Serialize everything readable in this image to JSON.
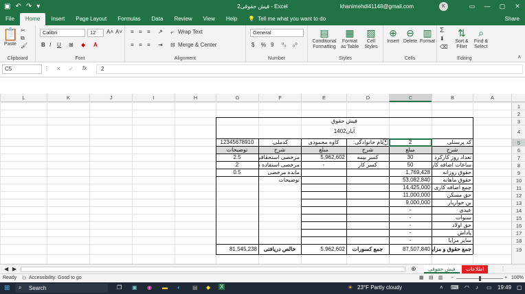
{
  "window": {
    "title": "فیش حقوقی2  -  Excel",
    "account": "khanimehdi41148@gmail.com",
    "avatar": "K",
    "min": "—",
    "max": "▢",
    "close": "✕"
  },
  "tabs": [
    "File",
    "Home",
    "Insert",
    "Page Layout",
    "Formulas",
    "Data",
    "Review",
    "View",
    "Help"
  ],
  "tell_me": "Tell me what you want to do",
  "share": "Share",
  "ribbon": {
    "clipboard": {
      "paste": "Paste",
      "label": "Clipboard"
    },
    "font": {
      "name": "Calibri",
      "size": "12",
      "label": "Font",
      "bold": "B",
      "italic": "I",
      "underline": "U"
    },
    "alignment": {
      "wrap": "Wrap Text",
      "merge": "Merge & Center",
      "label": "Alignment"
    },
    "number": {
      "format": "General",
      "label": "Number",
      "pct": "%",
      "comma": "9"
    },
    "styles": {
      "cond": "Conditional Formatting",
      "table": "Format as Table",
      "cell": "Cell Styles",
      "label": "Styles"
    },
    "cells": {
      "insert": "Insert",
      "delete": "Delete",
      "format": "Format",
      "label": "Cells"
    },
    "editing": {
      "sort": "Sort & Filter",
      "find": "Find & Select",
      "label": "Editing"
    }
  },
  "formula_bar": {
    "name_box": "C5",
    "fx": "fx",
    "value": "2"
  },
  "columns": [
    "L",
    "K",
    "J",
    "I",
    "H",
    "G",
    "F",
    "E",
    "D",
    "C",
    "B",
    "A"
  ],
  "rows": [
    "1",
    "2",
    "3",
    "4",
    "5",
    "6",
    "7",
    "8",
    "9",
    "10",
    "11",
    "12",
    "13",
    "14",
    "15",
    "16",
    "17",
    "18",
    "19"
  ],
  "sheet": {
    "title": "فیش حقوق",
    "month": "آبان1402",
    "personnel_label": "کد پرسنلی",
    "personnel_value": "2",
    "name_label": "و نام  خانوادگی:",
    "name_value": "کاوه محمودی",
    "id_label": "کدملی:",
    "id_value": "12345678910",
    "hdr_desc": "شرح",
    "hdr_amount": "مبلغ",
    "hdr_explain": "توضیحات",
    "earnings": [
      {
        "desc": "تعداد روز کارکرد",
        "amount": "30"
      },
      {
        "desc": "ساعات اضافه کار",
        "amount": "50"
      },
      {
        "desc": "حقوق روزانه",
        "amount": "1,769,428"
      },
      {
        "desc": "حقوق ماهانه",
        "amount": "53,082,840"
      },
      {
        "desc": "جمع اضافه کاری",
        "amount": "14,425,000"
      },
      {
        "desc": "حق مسکن",
        "amount": "11,000,000"
      },
      {
        "desc": "بن خواربار",
        "amount": "9,000,000"
      },
      {
        "desc": "عیدی",
        "amount": "-"
      },
      {
        "desc": "سنوات",
        "amount": "-"
      },
      {
        "desc": "حق اولاد",
        "amount": "-"
      },
      {
        "desc": "پاداش",
        "amount": "-"
      },
      {
        "desc": "سایر مزایا",
        "amount": "-"
      }
    ],
    "deductions": [
      {
        "desc": "کسر بیمه",
        "amount": "5,962,602"
      },
      {
        "desc": "کسر کار",
        "amount": "-"
      }
    ],
    "leave": [
      {
        "desc": "مرخصی استحقاقی",
        "amount": "2.5"
      },
      {
        "desc": "مرخصی استفاده شد",
        "amount": "2"
      },
      {
        "desc": "مانده مرخصی",
        "amount": "0.5"
      }
    ],
    "notes_label": "توضیحات",
    "total_earn_label": "جمع حقوق و مزایا",
    "total_earn": "87,507,840",
    "total_ded_label": "جمع کسورات",
    "total_ded": "5,962,602",
    "net_label": "خالص دریافتی",
    "net": "81,545,238"
  },
  "sheet_tabs": [
    "اطلاعات",
    "فیش حقوقی"
  ],
  "status": {
    "ready": "Ready",
    "access": "Accessibility: Good to go",
    "zoom": "100%"
  },
  "taskbar": {
    "search": "Search",
    "weather": "23°F  Partly cloudy",
    "time": "19:49"
  }
}
